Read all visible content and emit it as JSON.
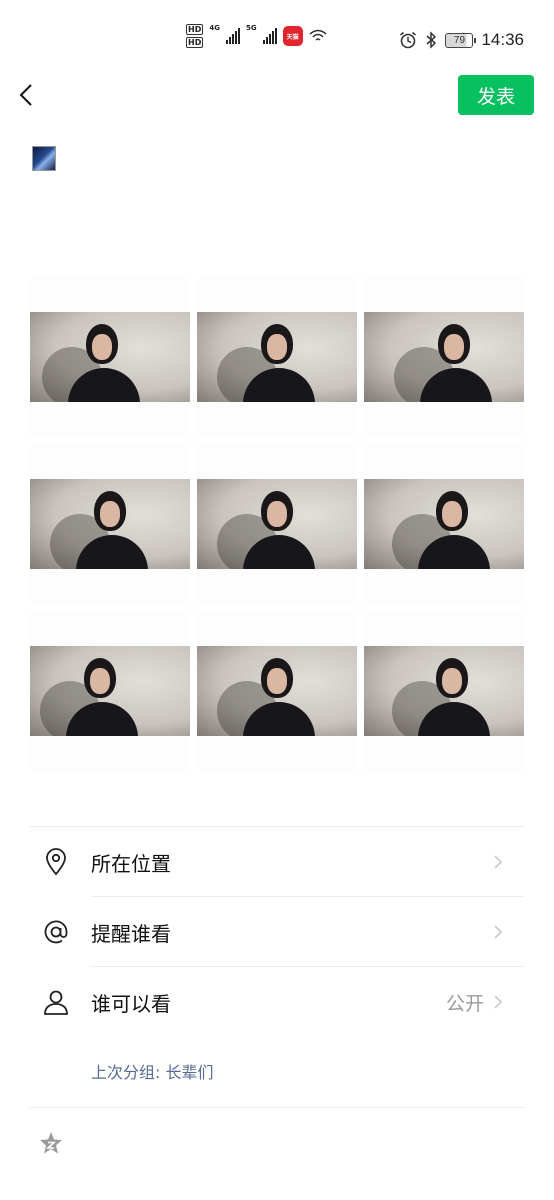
{
  "status_bar": {
    "hd1": "HD",
    "hd2": "HD",
    "net1": "4G",
    "net2": "5G",
    "app_badge": "天猫",
    "battery": "79",
    "time": "14:36"
  },
  "nav": {
    "publish_label": "发表"
  },
  "photo_grid": {
    "count": 9
  },
  "options": [
    {
      "label": "所在位置",
      "value": ""
    },
    {
      "label": "提醒谁看",
      "value": ""
    },
    {
      "label": "谁可以看",
      "value": "公开"
    }
  ],
  "last_group_text": "上次分组: 长辈们",
  "icons": {
    "back": "back-arrow-icon",
    "location": "location-pin-icon",
    "mention": "at-sign-icon",
    "visibility": "person-icon",
    "chevron": "chevron-right-icon",
    "footer": "star-badge-icon"
  },
  "colors": {
    "accent": "#07c160",
    "link": "#576b95",
    "secondary": "#9a9a9a"
  }
}
